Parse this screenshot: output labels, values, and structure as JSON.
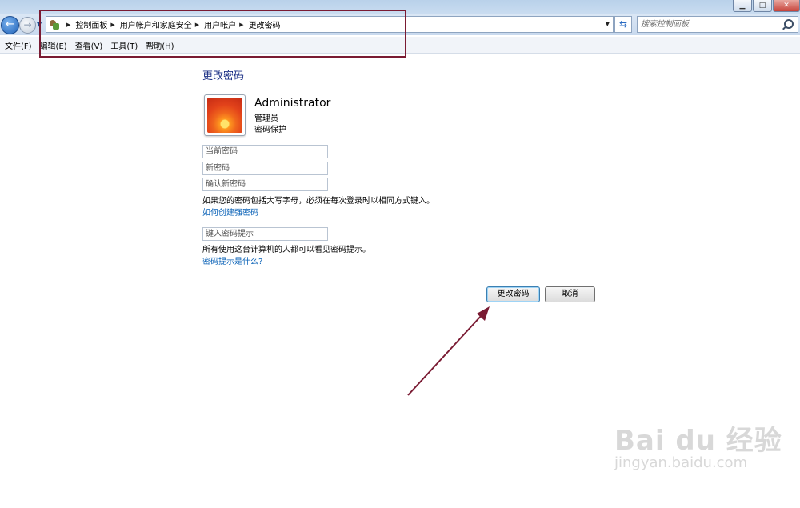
{
  "breadcrumb": {
    "items": [
      "控制面板",
      "用户帐户和家庭安全",
      "用户帐户",
      "更改密码"
    ]
  },
  "search": {
    "placeholder": "搜索控制面板"
  },
  "menu": [
    "文件(F)",
    "编辑(E)",
    "查看(V)",
    "工具(T)",
    "帮助(H)"
  ],
  "page": {
    "title": "更改密码",
    "user": {
      "name": "Administrator",
      "role": "管理员",
      "status": "密码保护"
    },
    "fields": {
      "current_password_placeholder": "当前密码",
      "new_password_placeholder": "新密码",
      "confirm_password_placeholder": "确认新密码",
      "hint_placeholder": "键入密码提示"
    },
    "case_note": "如果您的密码包括大写字母，必须在每次登录时以相同方式键入。",
    "strong_password_link": "如何创建强密码",
    "hint_note": "所有使用这台计算机的人都可以看见密码提示。",
    "hint_link": "密码提示是什么?"
  },
  "buttons": {
    "change": "更改密码",
    "cancel": "取消"
  },
  "watermark": {
    "logo": "Bai du 经验",
    "url": "jingyan.baidu.com"
  },
  "colors": {
    "title_blue": "#1e3287",
    "link_blue": "#0a62b7",
    "annotation": "#7a1b33"
  },
  "icons": [
    "back-arrow-icon",
    "forward-arrow-icon",
    "control-panel-icon",
    "refresh-icon",
    "search-icon"
  ]
}
